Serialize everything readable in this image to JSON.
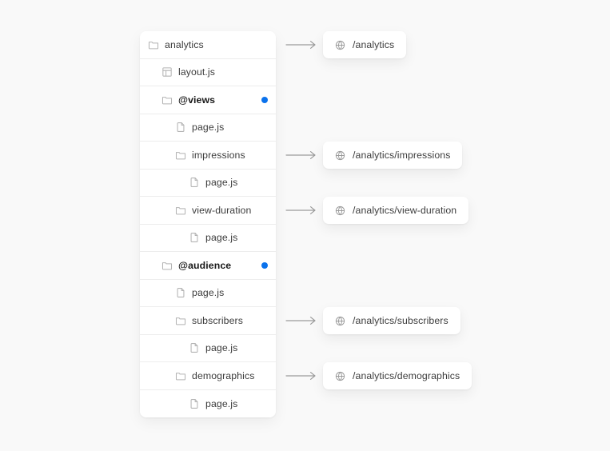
{
  "background_color": "#f9f9f9",
  "accent_color": "#0b72ec",
  "tree": {
    "panel_name": "file-tree-panel",
    "rows": [
      {
        "label": "analytics",
        "icon": "folder-icon",
        "level": 0,
        "bold": false,
        "badge": false
      },
      {
        "label": "layout.js",
        "icon": "layout-icon",
        "level": 1,
        "bold": false,
        "badge": false
      },
      {
        "label": "@views",
        "icon": "folder-icon",
        "level": 1,
        "bold": true,
        "badge": true
      },
      {
        "label": "page.js",
        "icon": "file-icon",
        "level": 2,
        "bold": false,
        "badge": false
      },
      {
        "label": "impressions",
        "icon": "folder-icon",
        "level": 2,
        "bold": false,
        "badge": false
      },
      {
        "label": "page.js",
        "icon": "file-icon",
        "level": 3,
        "bold": false,
        "badge": false
      },
      {
        "label": "view-duration",
        "icon": "folder-icon",
        "level": 2,
        "bold": false,
        "badge": false
      },
      {
        "label": "page.js",
        "icon": "file-icon",
        "level": 3,
        "bold": false,
        "badge": false
      },
      {
        "label": "@audience",
        "icon": "folder-icon",
        "level": 1,
        "bold": true,
        "badge": true
      },
      {
        "label": "page.js",
        "icon": "file-icon",
        "level": 2,
        "bold": false,
        "badge": false
      },
      {
        "label": "subscribers",
        "icon": "folder-icon",
        "level": 2,
        "bold": false,
        "badge": false
      },
      {
        "label": "page.js",
        "icon": "file-icon",
        "level": 3,
        "bold": false,
        "badge": false
      },
      {
        "label": "demographics",
        "icon": "folder-icon",
        "level": 2,
        "bold": false,
        "badge": false
      },
      {
        "label": "page.js",
        "icon": "file-icon",
        "level": 3,
        "bold": false,
        "badge": false
      }
    ]
  },
  "routes": [
    {
      "url": "/analytics",
      "icon": "globe-icon",
      "arrow": "arrow-right-icon",
      "row_index": 0
    },
    {
      "url": "/analytics/impressions",
      "icon": "globe-icon",
      "arrow": "arrow-right-icon",
      "row_index": 4
    },
    {
      "url": "/analytics/view-duration",
      "icon": "globe-icon",
      "arrow": "arrow-right-icon",
      "row_index": 6
    },
    {
      "url": "/analytics/subscribers",
      "icon": "globe-icon",
      "arrow": "arrow-right-icon",
      "row_index": 10
    },
    {
      "url": "/analytics/demographics",
      "icon": "globe-icon",
      "arrow": "arrow-right-icon",
      "row_index": 12
    }
  ]
}
